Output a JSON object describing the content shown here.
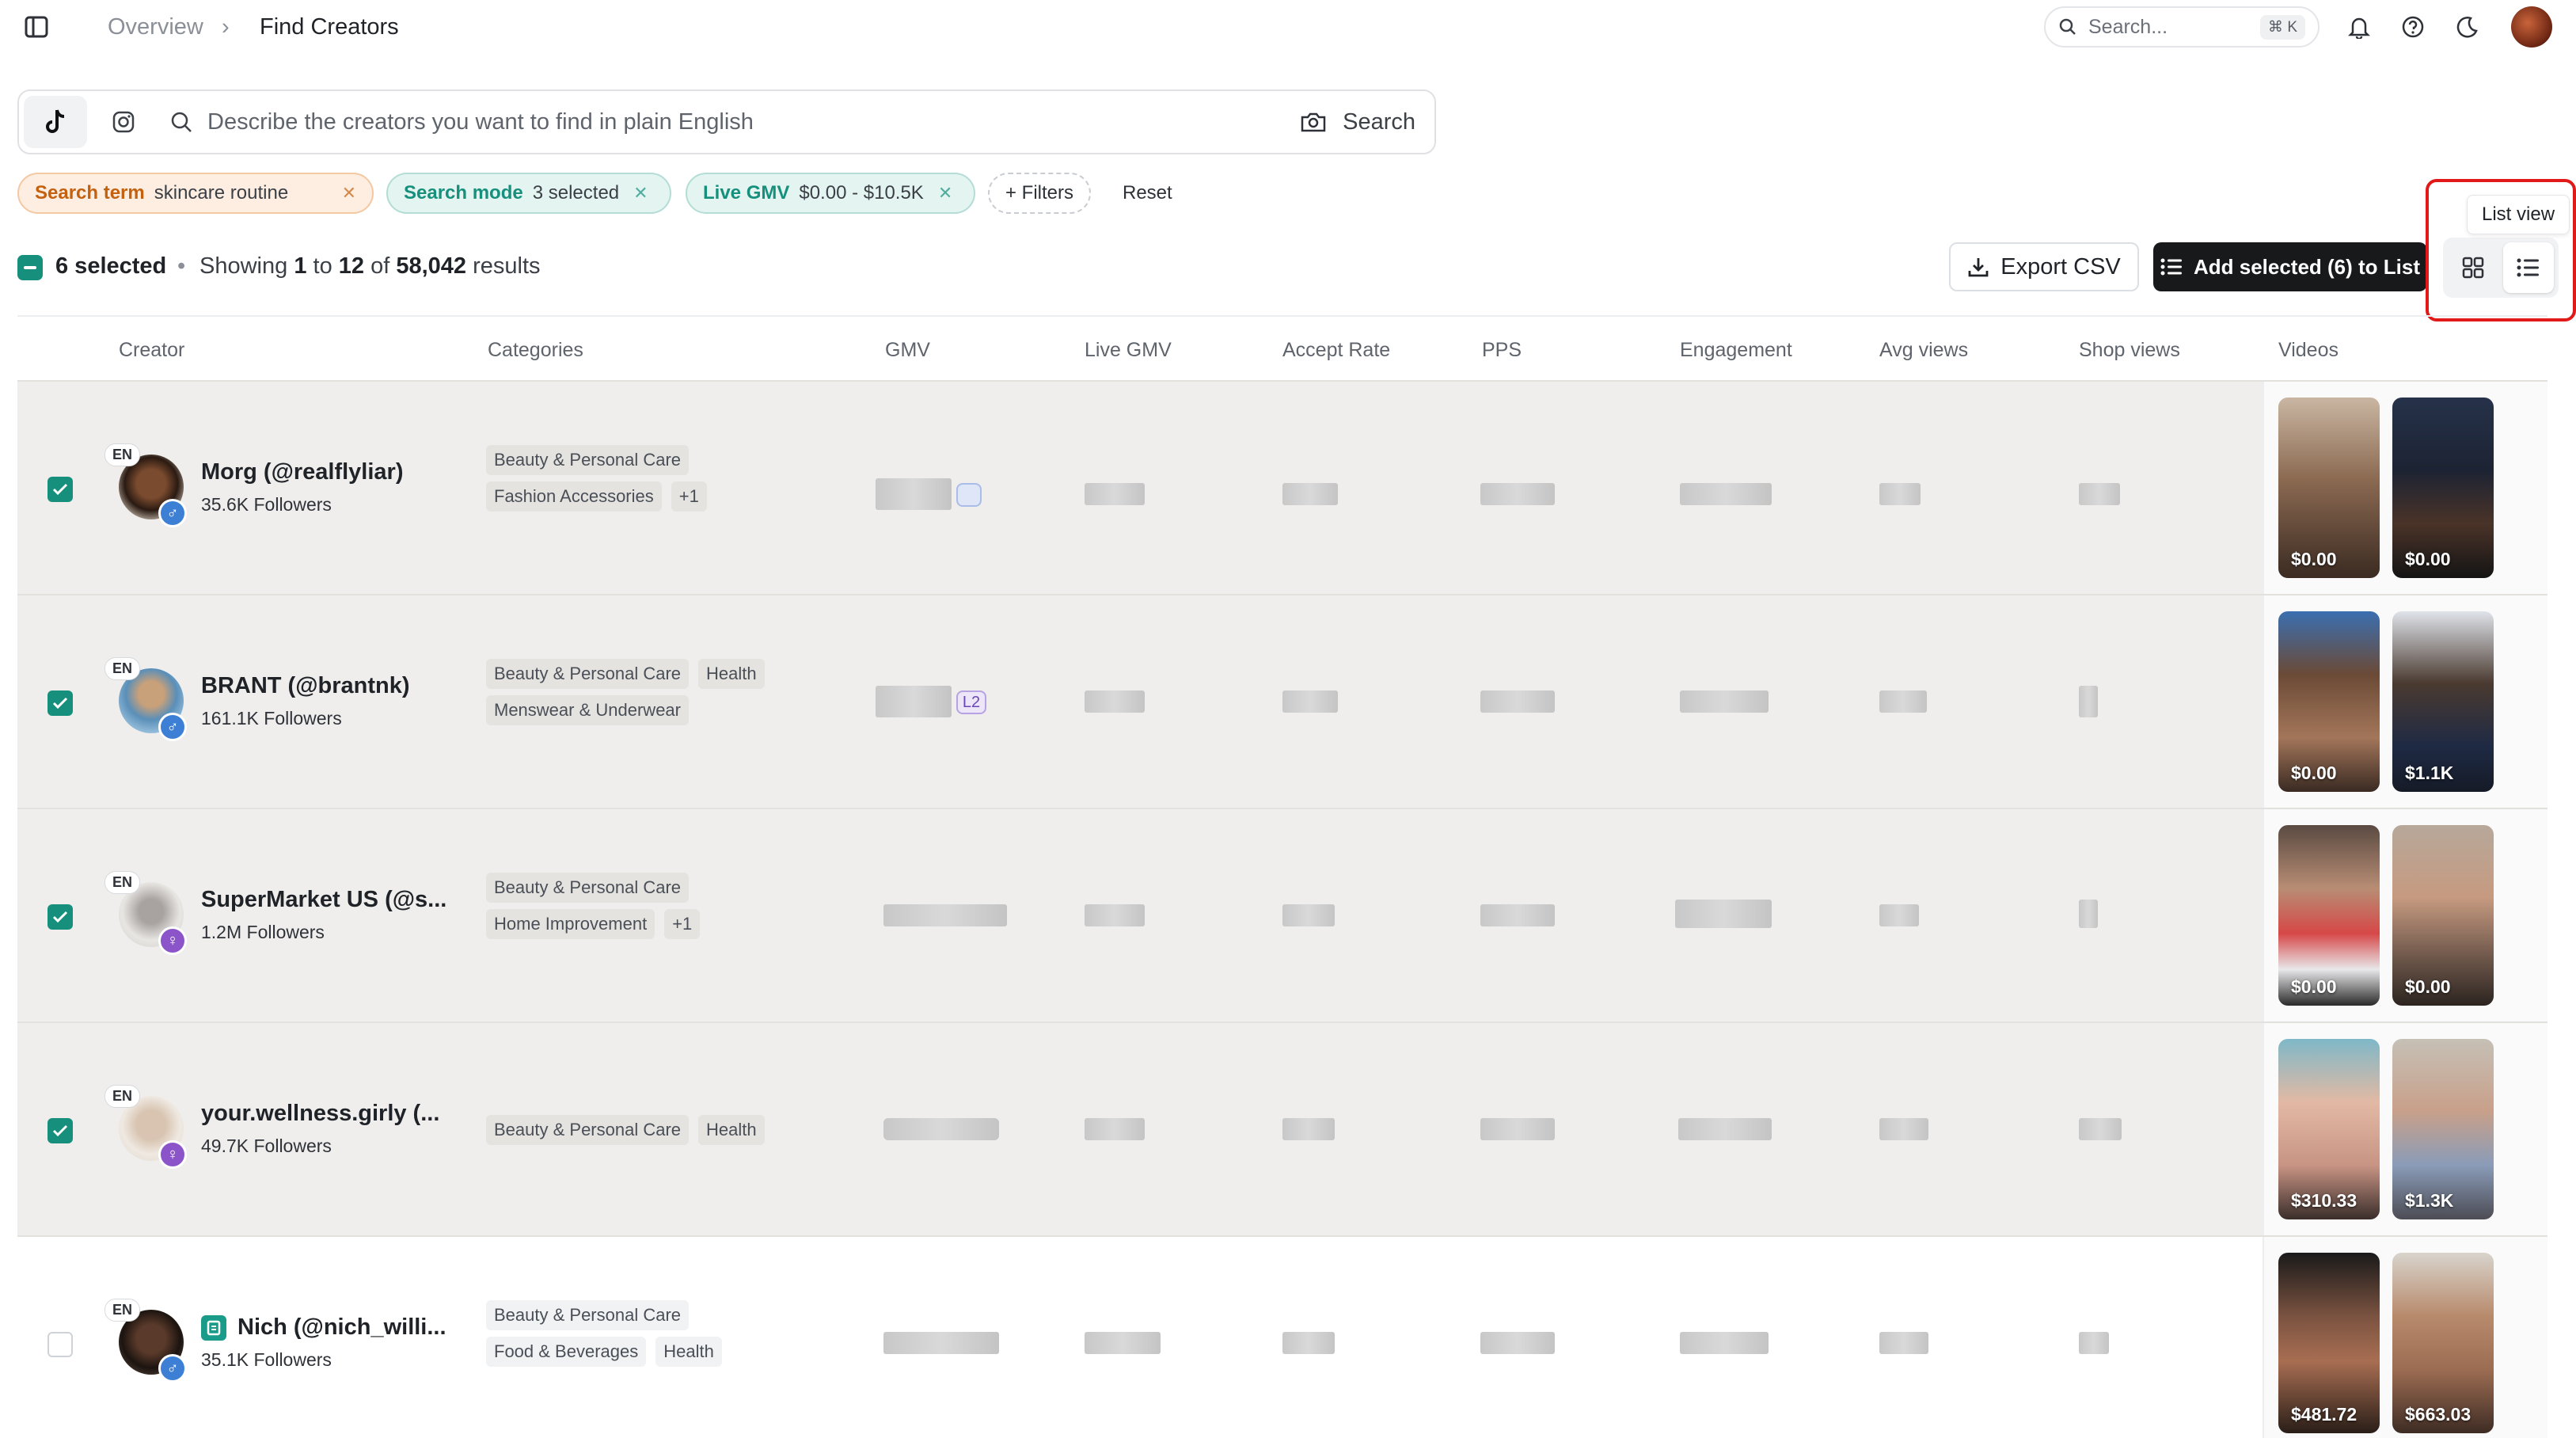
{
  "header": {
    "breadcrumb": [
      "Overview",
      "Find Creators"
    ],
    "search_placeholder": "Search...",
    "search_shortcut": "⌘ K"
  },
  "search": {
    "placeholder": "Describe the creators you want to find in plain English",
    "button": "Search"
  },
  "filters": [
    {
      "key": "Search term",
      "value": "skincare routine"
    },
    {
      "key": "Search mode",
      "value": "3 selected"
    },
    {
      "key": "Live GMV",
      "value": "$0.00 - $10.5K"
    }
  ],
  "add_filter_label": "+ Filters",
  "reset_label": "Reset",
  "selection": {
    "selected_label": "6 selected",
    "showing_prefix": "Showing",
    "from": "1",
    "to_word": "to",
    "to": "12",
    "of_word": "of",
    "total": "58,042",
    "suffix": "results"
  },
  "actions": {
    "export": "Export CSV",
    "add_selected": "Add selected (6) to List",
    "tooltip": "List view"
  },
  "columns": [
    "Creator",
    "Categories",
    "GMV",
    "Live GMV",
    "Accept Rate",
    "PPS",
    "Engagement",
    "Avg views",
    "Shop views",
    "Videos"
  ],
  "colors": {
    "accent": "#16907c",
    "highlight": "#e11919",
    "dark_button": "#18191b"
  },
  "rows": [
    {
      "name": "Morg (@realflyliar)",
      "followers": "35.6K Followers",
      "lang": "EN",
      "gender": "♂",
      "checked": true,
      "tags": [
        "Beauty & Personal Care",
        "Fashion Accessories",
        "+1"
      ],
      "videos": [
        "$0.00",
        "$0.00"
      ]
    },
    {
      "name": "BRANT (@brantnk)",
      "followers": "161.1K Followers",
      "lang": "EN",
      "gender": "♂",
      "checked": true,
      "tags": [
        "Beauty & Personal Care",
        "Health",
        "Menswear & Underwear"
      ],
      "videos": [
        "$0.00",
        "$1.1K"
      ],
      "gmv_badge": "L2"
    },
    {
      "name": "SuperMarket US (@s...",
      "followers": "1.2M Followers",
      "lang": "EN",
      "gender": "♀",
      "checked": true,
      "tags": [
        "Beauty & Personal Care",
        "Home Improvement",
        "+1"
      ],
      "videos": [
        "$0.00",
        "$0.00"
      ]
    },
    {
      "name": "your.wellness.girly (...",
      "followers": "49.7K Followers",
      "lang": "EN",
      "gender": "♀",
      "checked": true,
      "tags": [
        "Beauty & Personal Care",
        "Health"
      ],
      "videos": [
        "$310.33",
        "$1.3K"
      ]
    },
    {
      "name": "Nich (@nich_willi...",
      "followers": "35.1K Followers",
      "lang": "EN",
      "gender": "♂",
      "checked": false,
      "tags": [
        "Beauty & Personal Care",
        "Food & Beverages",
        "Health"
      ],
      "videos": [
        "$481.72",
        "$663.03"
      ]
    }
  ]
}
